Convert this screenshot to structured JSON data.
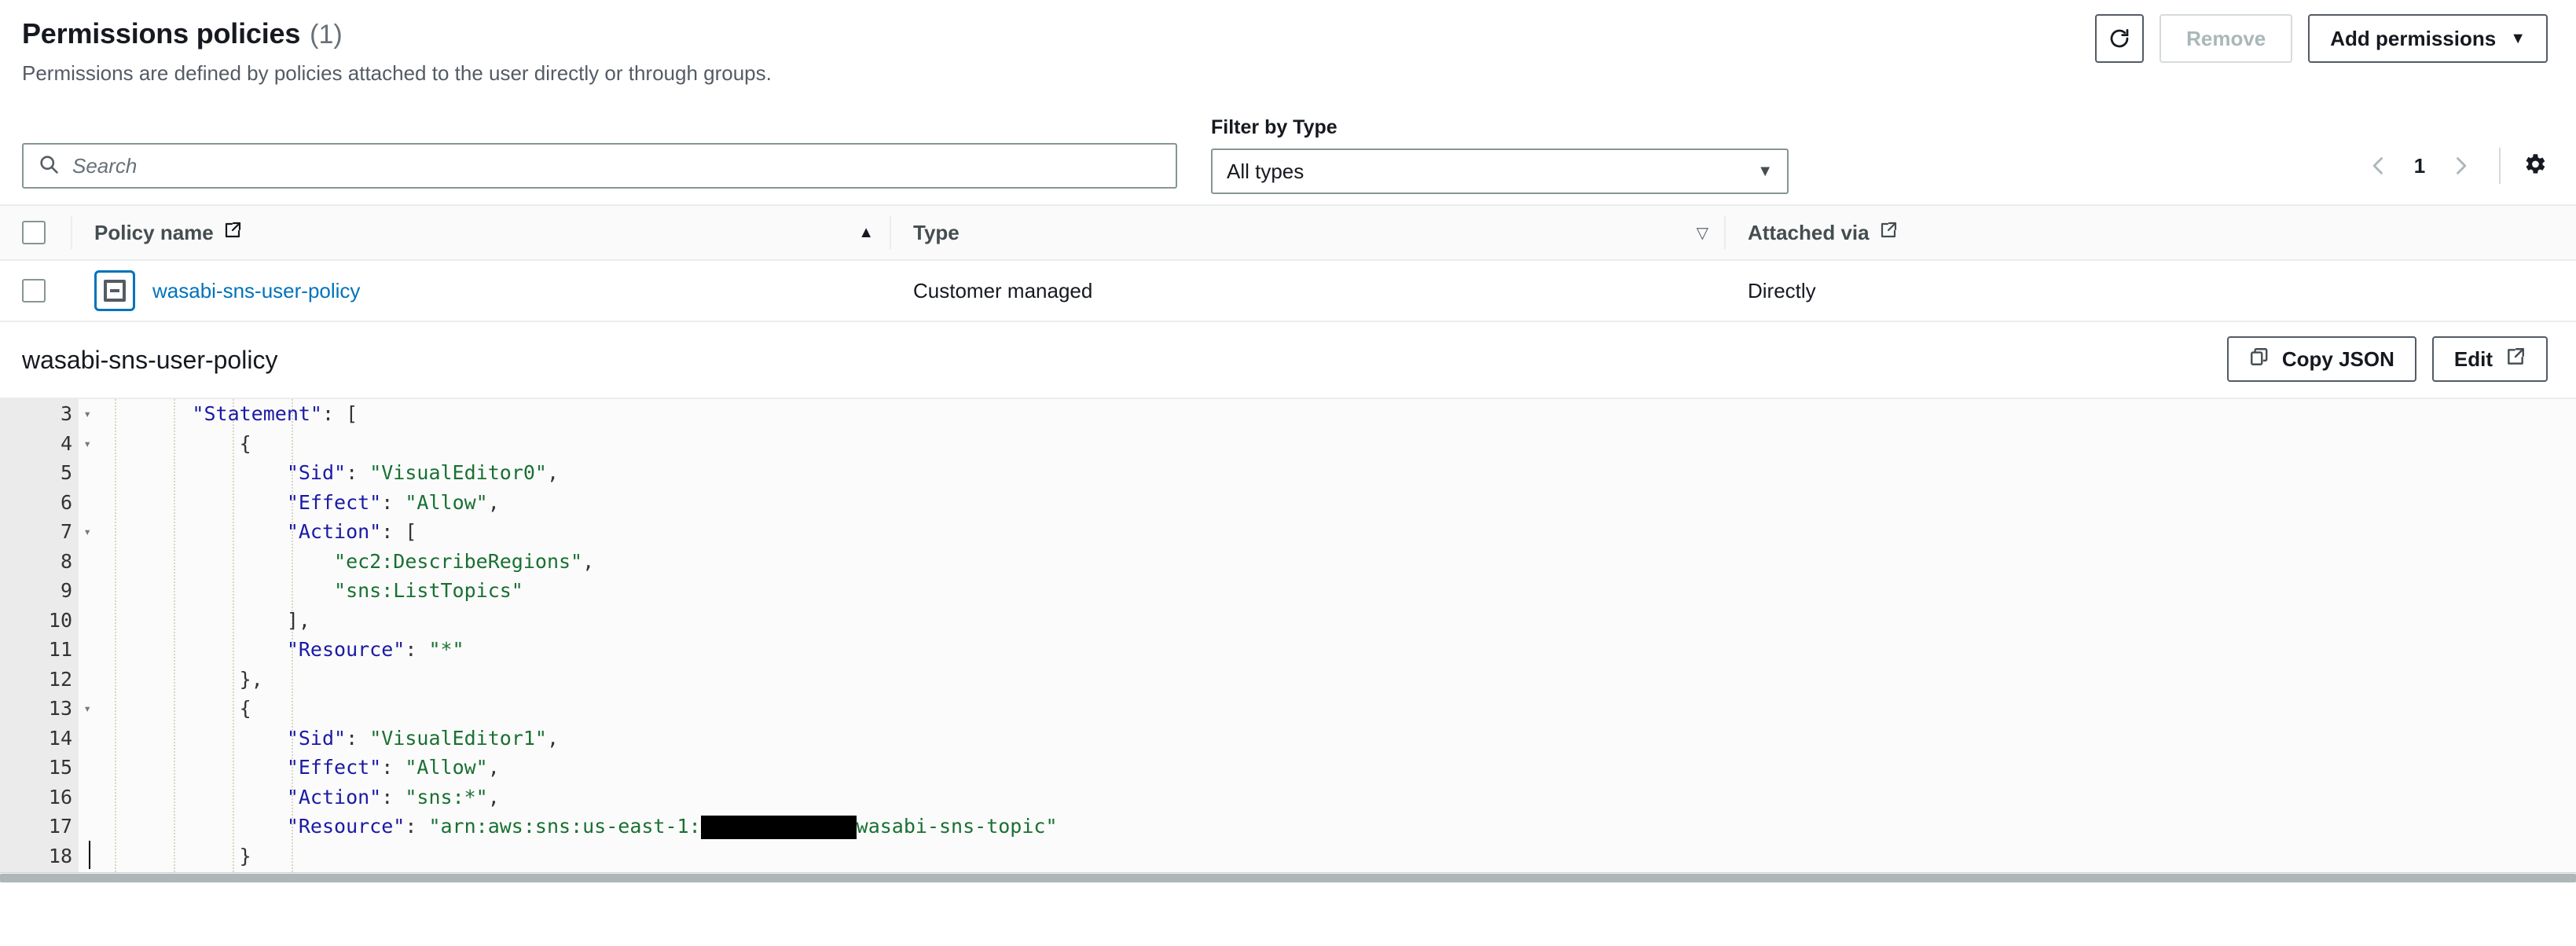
{
  "header": {
    "title": "Permissions policies",
    "count": "(1)",
    "subtitle": "Permissions are defined by policies attached to the user directly or through groups.",
    "refresh_icon": "refresh-icon",
    "remove_label": "Remove",
    "add_permissions_label": "Add permissions",
    "add_permissions_caret": "▼"
  },
  "filters": {
    "search_placeholder": "Search",
    "search_value": "",
    "search_icon": "search-icon",
    "filter_label": "Filter by Type",
    "filter_selected": "All types",
    "filter_caret": "▼",
    "page_number": "1",
    "prev_icon": "chevron-left-icon",
    "next_icon": "chevron-right-icon",
    "settings_icon": "gear-icon"
  },
  "table": {
    "columns": [
      {
        "label": "Policy name",
        "external_icon": "external-link-icon",
        "sort": "▲"
      },
      {
        "label": "Type",
        "external_icon": "",
        "sort": "▽"
      },
      {
        "label": "Attached via",
        "external_icon": "external-link-icon",
        "sort": ""
      }
    ],
    "rows": [
      {
        "expander_icon": "collapse-minus-icon",
        "policy_name": "wasabi-sns-user-policy",
        "type": "Customer managed",
        "attached_via": "Directly"
      }
    ]
  },
  "detail": {
    "title": "wasabi-sns-user-policy",
    "copy_json_label": "Copy JSON",
    "copy_icon": "copy-icon",
    "edit_label": "Edit",
    "edit_icon": "external-link-icon"
  },
  "editor": {
    "lines": [
      {
        "num": "3",
        "fold": "▾",
        "indent": 2,
        "tokens": [
          {
            "t": "k",
            "v": "\"Statement\""
          },
          {
            "t": "p",
            "v": ": ["
          }
        ]
      },
      {
        "num": "4",
        "fold": "▾",
        "indent": 3,
        "tokens": [
          {
            "t": "p",
            "v": "{"
          }
        ]
      },
      {
        "num": "5",
        "fold": "",
        "indent": 4,
        "tokens": [
          {
            "t": "k",
            "v": "\"Sid\""
          },
          {
            "t": "p",
            "v": ": "
          },
          {
            "t": "s",
            "v": "\"VisualEditor0\""
          },
          {
            "t": "p",
            "v": ","
          }
        ]
      },
      {
        "num": "6",
        "fold": "",
        "indent": 4,
        "tokens": [
          {
            "t": "k",
            "v": "\"Effect\""
          },
          {
            "t": "p",
            "v": ": "
          },
          {
            "t": "s",
            "v": "\"Allow\""
          },
          {
            "t": "p",
            "v": ","
          }
        ]
      },
      {
        "num": "7",
        "fold": "▾",
        "indent": 4,
        "tokens": [
          {
            "t": "k",
            "v": "\"Action\""
          },
          {
            "t": "p",
            "v": ": ["
          }
        ]
      },
      {
        "num": "8",
        "fold": "",
        "indent": 5,
        "tokens": [
          {
            "t": "s",
            "v": "\"ec2:DescribeRegions\""
          },
          {
            "t": "p",
            "v": ","
          }
        ]
      },
      {
        "num": "9",
        "fold": "",
        "indent": 5,
        "tokens": [
          {
            "t": "s",
            "v": "\"sns:ListTopics\""
          }
        ]
      },
      {
        "num": "10",
        "fold": "",
        "indent": 4,
        "tokens": [
          {
            "t": "p",
            "v": "],"
          }
        ]
      },
      {
        "num": "11",
        "fold": "",
        "indent": 4,
        "tokens": [
          {
            "t": "k",
            "v": "\"Resource\""
          },
          {
            "t": "p",
            "v": ": "
          },
          {
            "t": "s",
            "v": "\"*\""
          }
        ]
      },
      {
        "num": "12",
        "fold": "",
        "indent": 3,
        "tokens": [
          {
            "t": "p",
            "v": "},"
          }
        ]
      },
      {
        "num": "13",
        "fold": "▾",
        "indent": 3,
        "tokens": [
          {
            "t": "p",
            "v": "{"
          }
        ]
      },
      {
        "num": "14",
        "fold": "",
        "indent": 4,
        "tokens": [
          {
            "t": "k",
            "v": "\"Sid\""
          },
          {
            "t": "p",
            "v": ": "
          },
          {
            "t": "s",
            "v": "\"VisualEditor1\""
          },
          {
            "t": "p",
            "v": ","
          }
        ]
      },
      {
        "num": "15",
        "fold": "",
        "indent": 4,
        "tokens": [
          {
            "t": "k",
            "v": "\"Effect\""
          },
          {
            "t": "p",
            "v": ": "
          },
          {
            "t": "s",
            "v": "\"Allow\""
          },
          {
            "t": "p",
            "v": ","
          }
        ]
      },
      {
        "num": "16",
        "fold": "",
        "indent": 4,
        "tokens": [
          {
            "t": "k",
            "v": "\"Action\""
          },
          {
            "t": "p",
            "v": ": "
          },
          {
            "t": "s",
            "v": "\"sns:*\""
          },
          {
            "t": "p",
            "v": ","
          }
        ]
      },
      {
        "num": "17",
        "fold": "",
        "indent": 4,
        "tokens": [
          {
            "t": "k",
            "v": "\"Resource\""
          },
          {
            "t": "p",
            "v": ": "
          },
          {
            "t": "s",
            "v": "\"arn:aws:sns:us-east-1:"
          },
          {
            "t": "redact",
            "v": "            "
          },
          {
            "t": "s",
            "v": "wasabi-sns-topic\""
          }
        ]
      },
      {
        "num": "18",
        "fold": "",
        "indent": 3,
        "tokens": [
          {
            "t": "p",
            "v": "}"
          }
        ]
      }
    ]
  },
  "colors": {
    "link": "#0073bb",
    "json_key": "#1a1aa6",
    "json_string": "#197032",
    "border": "#eaeded",
    "text": "#16191f",
    "muted": "#687078"
  }
}
